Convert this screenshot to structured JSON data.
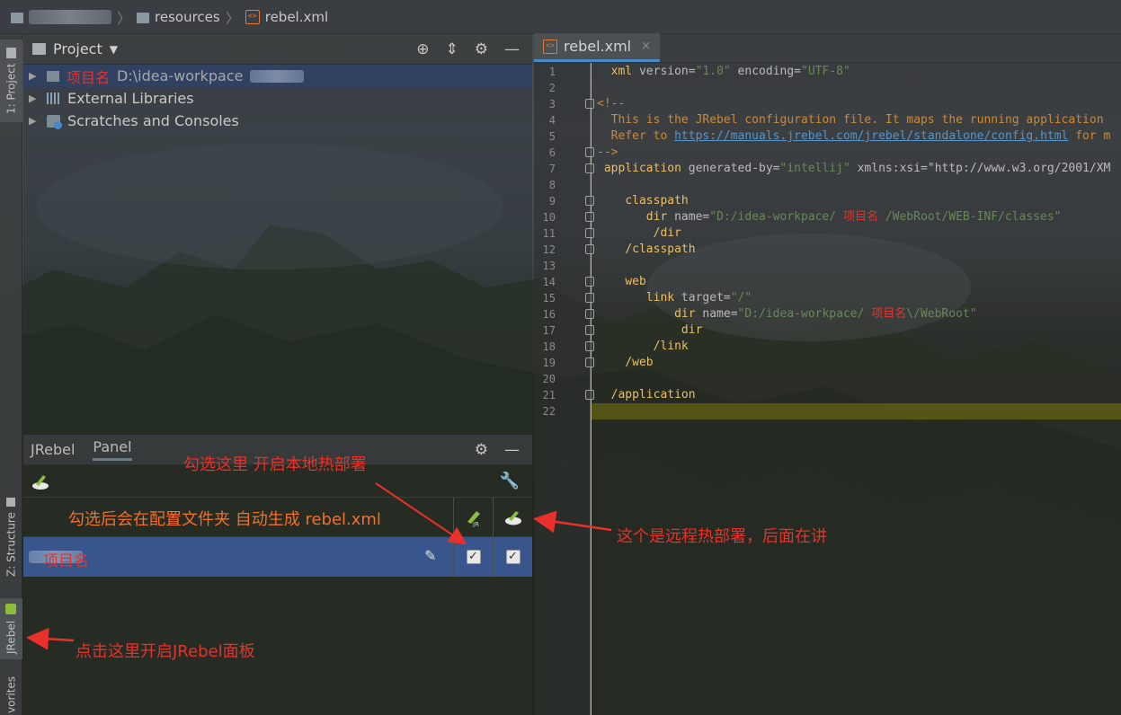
{
  "breadcrumb": {
    "items": [
      "resources",
      "rebel.xml"
    ]
  },
  "left_strip": {
    "project_tab": "1: Project",
    "structure_tab": "Z: Structure",
    "jrebel_tab": "JRebel",
    "favorites_tab": "vorites"
  },
  "project_panel": {
    "title": "Project",
    "tree": [
      {
        "label": "项目名",
        "path": "D:\\idea-workpace"
      },
      {
        "label": "External Libraries"
      },
      {
        "label": "Scratches and Consoles"
      }
    ]
  },
  "jrebel_panel": {
    "tabs": [
      "JRebel",
      "Panel"
    ],
    "project_name": "项目名"
  },
  "editor": {
    "tab_label": "rebel.xml",
    "tab_close": "×",
    "lines": [
      {
        "n": "1",
        "text": "  xml version=\"1.0\" encoding=\"UTF-8\""
      },
      {
        "n": "2",
        "text": ""
      },
      {
        "n": "3",
        "text": "<!--"
      },
      {
        "n": "4",
        "text": "  This is the JRebel configuration file. It maps the running application"
      },
      {
        "n": "5",
        "text": "  Refer to https://manuals.jrebel.com/jrebel/standalone/config.html for m"
      },
      {
        "n": "6",
        "text": "-->"
      },
      {
        "n": "7",
        "text": " application generated-by=\"intellij\" xmlns:xsi=\"http://www.w3.org/2001/XM"
      },
      {
        "n": "8",
        "text": ""
      },
      {
        "n": "9",
        "text": "    classpath"
      },
      {
        "n": "10",
        "text": "       dir name=\"D:/idea-workpace/ 项目名 /WebRoot/WEB-INF/classes\""
      },
      {
        "n": "11",
        "text": "        /dir"
      },
      {
        "n": "12",
        "text": "    /classpath"
      },
      {
        "n": "13",
        "text": ""
      },
      {
        "n": "14",
        "text": "    web"
      },
      {
        "n": "15",
        "text": "       link target=\"/\""
      },
      {
        "n": "16",
        "text": "           dir name=\"D:/idea-workpace/ 项目名\\/WebRoot\""
      },
      {
        "n": "17",
        "text": "            dir"
      },
      {
        "n": "18",
        "text": "        /link"
      },
      {
        "n": "19",
        "text": "    /web"
      },
      {
        "n": "20",
        "text": ""
      },
      {
        "n": "21",
        "text": "  /application"
      },
      {
        "n": "22",
        "text": ""
      }
    ]
  },
  "annotations": {
    "check_here": "勾选这里 开启本地热部署",
    "auto_generate": "勾选后会在配置文件夹 自动生成 rebel.xml",
    "remote": "这个是远程热部署，后面在讲",
    "click_here": "点击这里开启JRebel面板"
  },
  "colors": {
    "annotation_red": "#e8312b",
    "annotation_orange": "#f07028",
    "selection_blue": "#3b5a96",
    "xml_tag": "#e8bf6a",
    "xml_value": "#6a8759",
    "current_line": "#5c5c14"
  }
}
